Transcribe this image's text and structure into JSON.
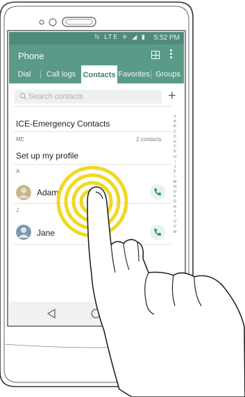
{
  "status_bar": {
    "icons": "ℕ LTE ⁜ ◢ ▮",
    "time": "5:52 PM"
  },
  "app_bar": {
    "title": "Phone"
  },
  "tabs": [
    {
      "label": "Dial",
      "active": false
    },
    {
      "label": "Call logs",
      "active": false
    },
    {
      "label": "Contacts",
      "active": true
    },
    {
      "label": "Favorites",
      "active": false
    },
    {
      "label": "Groups",
      "active": false
    }
  ],
  "search": {
    "placeholder": "Search contacts"
  },
  "ice_label": "ICE-Emergency Contacts",
  "me_section": {
    "header": "ME",
    "count": "2 contacts",
    "profile_label": "Set up my profile"
  },
  "contacts": [
    {
      "section": "A",
      "name": "Adam"
    },
    {
      "section": "J",
      "name": "Jane"
    }
  ],
  "alpha_index": [
    "#",
    "A",
    "B",
    "C",
    "D",
    "E",
    "F",
    "G",
    "H",
    "I",
    "J",
    "K",
    "L",
    "M",
    "N",
    "O",
    "P",
    "Q",
    "R",
    "S",
    "T",
    "U",
    "V",
    "W"
  ],
  "colors": {
    "accent": "#5a9a89",
    "status_bar": "#4f8b7c",
    "call_green": "#2f9a5f",
    "touch_ring": "#f2d81f"
  },
  "icons": {
    "search": "search-icon",
    "add": "plus-icon",
    "call": "phone-icon",
    "back": "back-triangle-icon",
    "home": "home-circle-icon",
    "menu": "kebab-menu-icon",
    "dialpad": "dialpad-grid-icon"
  }
}
